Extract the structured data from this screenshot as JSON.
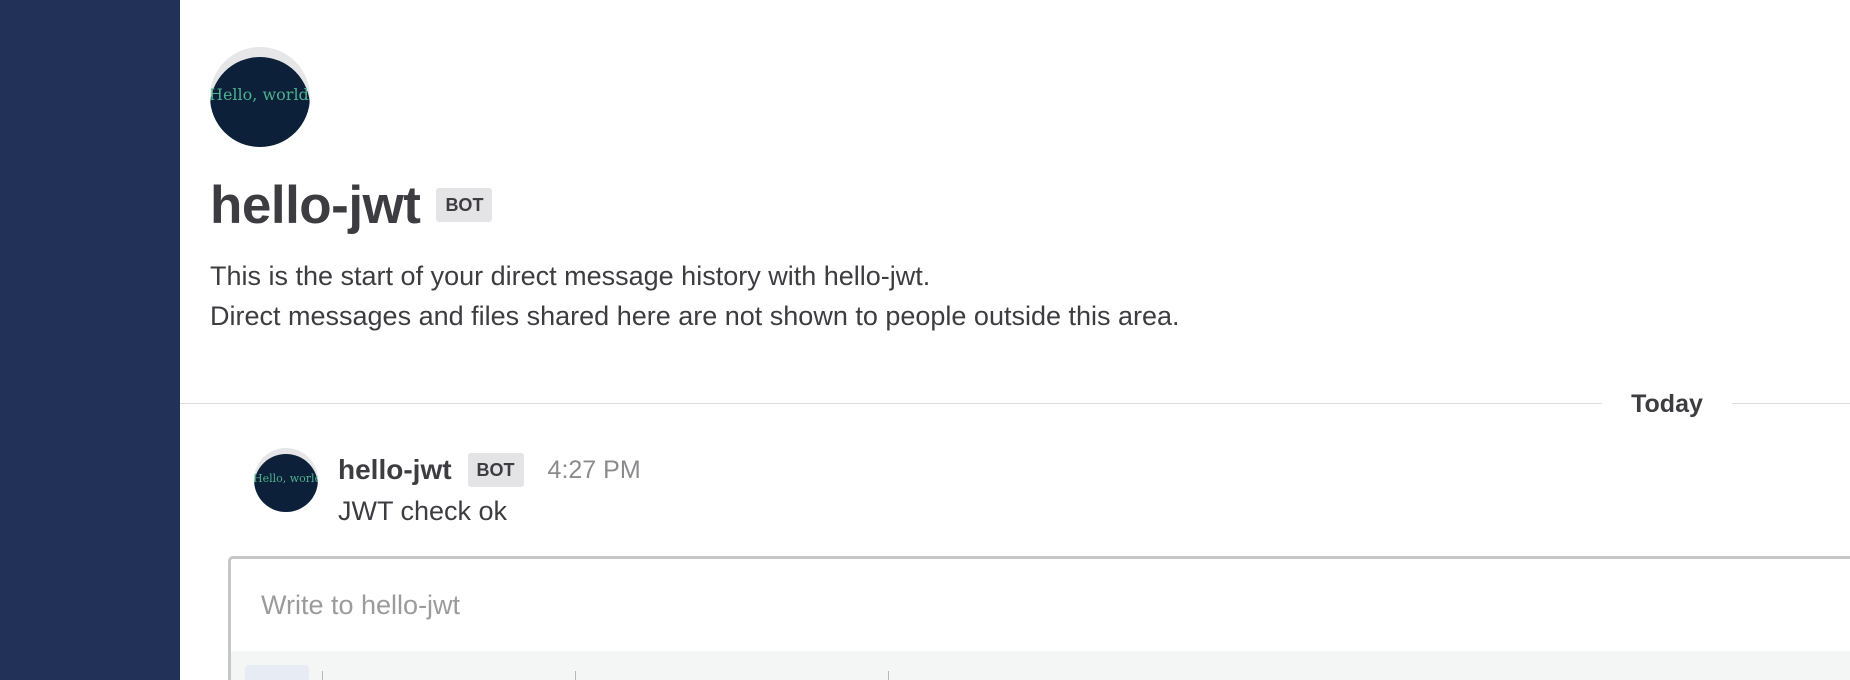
{
  "bot": {
    "name": "hello-jwt",
    "badge": "BOT",
    "avatar_text": "Hello, world"
  },
  "intro": {
    "line1": "This is the start of your direct message history with hello-jwt.",
    "line2": "Direct messages and files shared here are not shown to people outside this area."
  },
  "date_separator": "Today",
  "messages": [
    {
      "author": "hello-jwt",
      "badge": "BOT",
      "time": "4:27 PM",
      "text": "JWT check ok"
    }
  ],
  "composer": {
    "placeholder": "Write to hello-jwt"
  },
  "colors": {
    "sidebar": "#223158",
    "avatar_bg": "#0c2039",
    "avatar_text": "#4db18e"
  }
}
